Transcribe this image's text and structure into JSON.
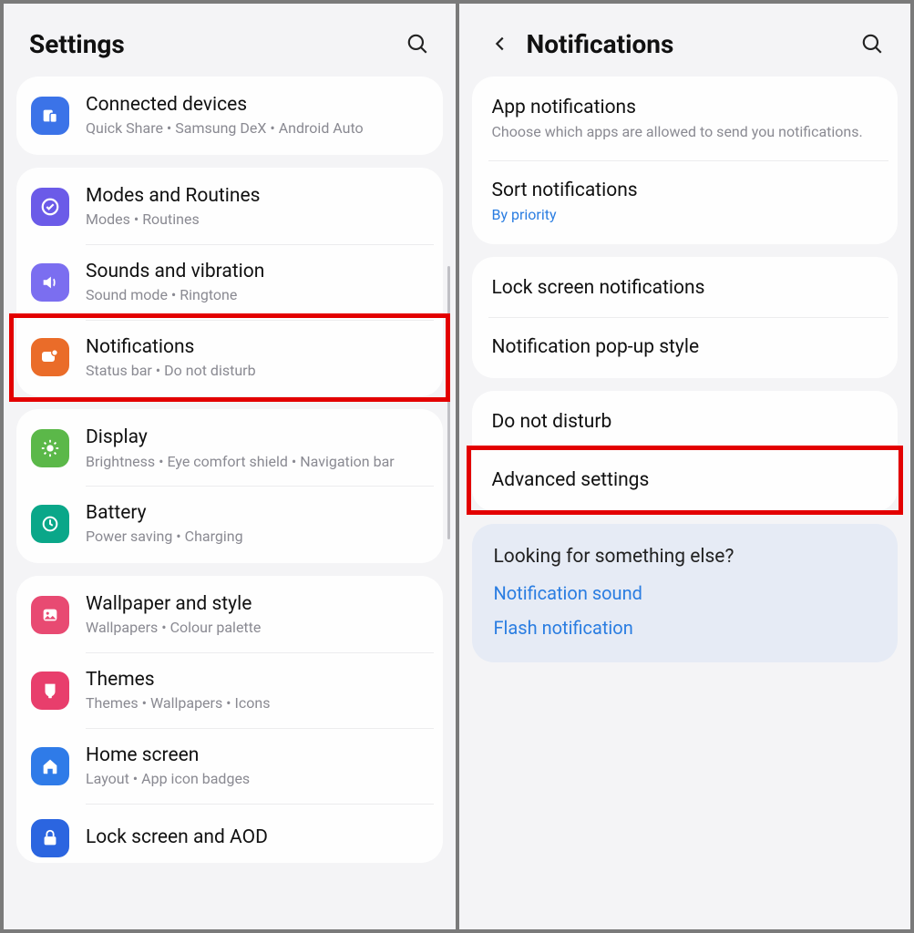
{
  "left": {
    "title": "Settings",
    "groups": [
      {
        "rows": [
          {
            "icon": "ic-blue",
            "glyph": "devices",
            "title": "Connected devices",
            "sub": "Quick Share  •  Samsung DeX  •  Android Auto"
          }
        ]
      },
      {
        "rows": [
          {
            "icon": "ic-purple",
            "glyph": "check-circle",
            "title": "Modes and Routines",
            "sub": "Modes  •  Routines"
          },
          {
            "icon": "ic-purple2",
            "glyph": "volume",
            "title": "Sounds and vibration",
            "sub": "Sound mode  •  Ringtone"
          },
          {
            "icon": "ic-orange",
            "glyph": "bell",
            "title": "Notifications",
            "sub": "Status bar  •  Do not disturb",
            "highlight": true
          }
        ]
      },
      {
        "rows": [
          {
            "icon": "ic-green",
            "glyph": "sun",
            "title": "Display",
            "sub": "Brightness  •  Eye comfort shield  •  Navigation bar"
          },
          {
            "icon": "ic-teal",
            "glyph": "battery",
            "title": "Battery",
            "sub": "Power saving  •  Charging"
          }
        ]
      },
      {
        "rows": [
          {
            "icon": "ic-pink",
            "glyph": "image",
            "title": "Wallpaper and style",
            "sub": "Wallpapers  •  Colour palette"
          },
          {
            "icon": "ic-pink2",
            "glyph": "brush",
            "title": "Themes",
            "sub": "Themes  •  Wallpapers  •  Icons"
          },
          {
            "icon": "ic-blue2",
            "glyph": "home",
            "title": "Home screen",
            "sub": "Layout  •  App icon badges"
          },
          {
            "icon": "ic-navy",
            "glyph": "lock",
            "title": "Lock screen and AOD",
            "sub": ""
          }
        ]
      }
    ]
  },
  "right": {
    "title": "Notifications",
    "groups": [
      {
        "rows": [
          {
            "title": "App notifications",
            "sub": "Choose which apps are allowed to send you notifications."
          },
          {
            "title": "Sort notifications",
            "sub": "By priority",
            "subLink": true
          }
        ]
      },
      {
        "rows": [
          {
            "title": "Lock screen notifications"
          },
          {
            "title": "Notification pop-up style"
          }
        ]
      },
      {
        "rows": [
          {
            "title": "Do not disturb"
          },
          {
            "title": "Advanced settings",
            "highlight": true
          }
        ]
      }
    ],
    "suggest": {
      "title": "Looking for something else?",
      "links": [
        "Notification sound",
        "Flash notification"
      ]
    }
  }
}
